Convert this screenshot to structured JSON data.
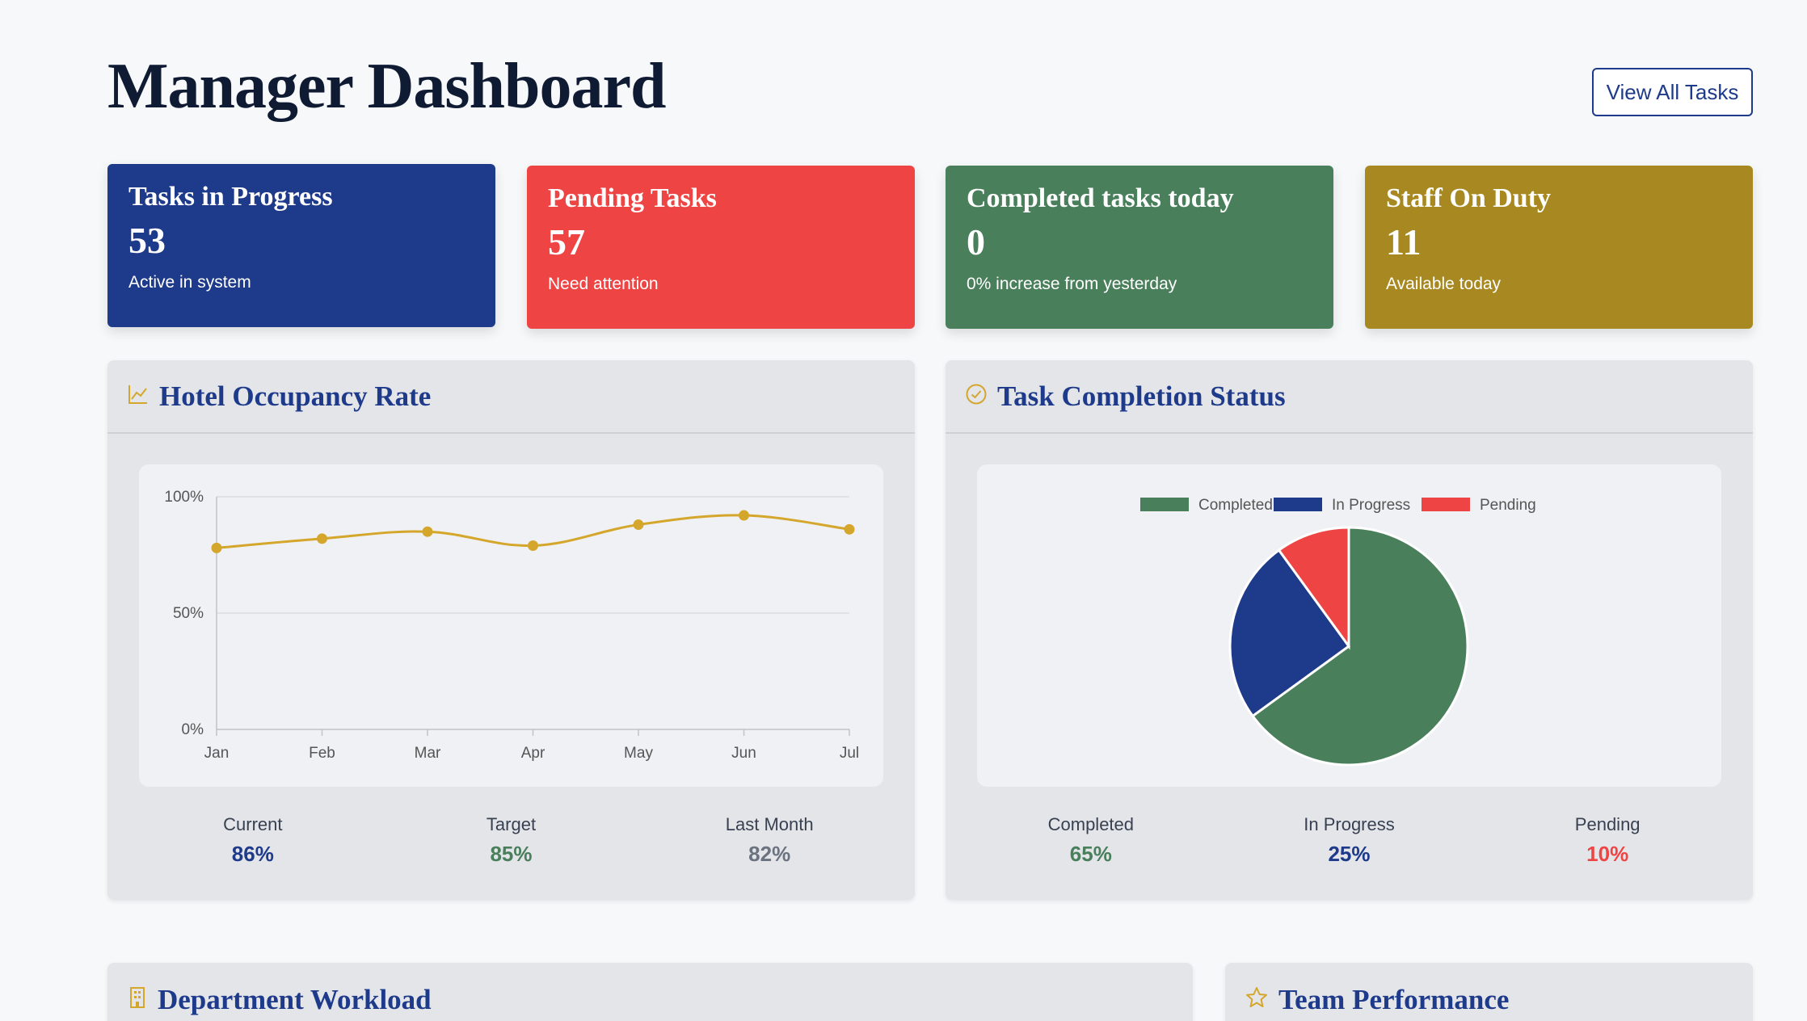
{
  "header": {
    "title": "Manager Dashboard",
    "view_all_label": "View All Tasks"
  },
  "cards": [
    {
      "title": "Tasks in Progress",
      "value": "53",
      "subtitle": "Active in system",
      "color": "#1e3a8a"
    },
    {
      "title": "Pending Tasks",
      "value": "57",
      "subtitle": "Need attention",
      "color": "#ef4444"
    },
    {
      "title": "Completed tasks today",
      "value": "0",
      "subtitle": "0% increase from yesterday",
      "color": "#4a7f5c"
    },
    {
      "title": "Staff On Duty",
      "value": "11",
      "subtitle": "Available today",
      "color": "#a88820"
    }
  ],
  "occupancy": {
    "title": "Hotel Occupancy Rate",
    "icon": "line-chart-icon",
    "stats": [
      {
        "label": "Current",
        "value": "86%",
        "color": "#1e3a8a"
      },
      {
        "label": "Target",
        "value": "85%",
        "color": "#4a7f5c"
      },
      {
        "label": "Last Month",
        "value": "82%",
        "color": "#6b7280"
      }
    ]
  },
  "completion": {
    "title": "Task Completion Status",
    "icon": "check-circle-icon",
    "stats": [
      {
        "label": "Completed",
        "value": "65%",
        "color": "#4a7f5c"
      },
      {
        "label": "In Progress",
        "value": "25%",
        "color": "#1e3a8a"
      },
      {
        "label": "Pending",
        "value": "10%",
        "color": "#ef4444"
      }
    ]
  },
  "workload": {
    "title": "Department Workload",
    "icon": "building-icon"
  },
  "team": {
    "title": "Team Performance",
    "icon": "star-icon"
  },
  "chart_data": [
    {
      "type": "line",
      "categories": [
        "Jan",
        "Feb",
        "Mar",
        "Apr",
        "May",
        "Jun",
        "Jul"
      ],
      "values": [
        78,
        82,
        85,
        79,
        88,
        92,
        86
      ],
      "yticks": [
        "0%",
        "50%",
        "100%"
      ],
      "ylim": [
        0,
        100
      ],
      "color": "#d4a72c",
      "grid": true
    },
    {
      "type": "pie",
      "labels": [
        "Completed",
        "In Progress",
        "Pending"
      ],
      "values": [
        65,
        25,
        10
      ],
      "colors": [
        "#4a7f5c",
        "#1e3a8a",
        "#ef4444"
      ],
      "legend": "top"
    }
  ]
}
